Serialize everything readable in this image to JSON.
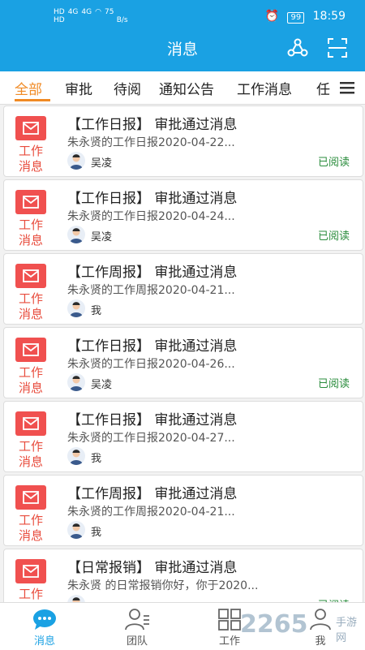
{
  "status_bar": {
    "left_top": "HD",
    "left_bottom": "HD",
    "net1": "4G",
    "net2": "4G",
    "speed_value": "75",
    "speed_unit": "B/s",
    "battery": "99",
    "time": "18:59"
  },
  "header": {
    "title": "消息",
    "left_icon": "share-icon",
    "right_icon": "scan-icon"
  },
  "tabs": [
    "全部",
    "审批",
    "待阅",
    "通知公告",
    "工作消息",
    "任"
  ],
  "messages": [
    {
      "category": "工作消息",
      "title": "【工作日报】 审批通过消息",
      "preview": "朱永贤的工作日报2020-04-22...",
      "author": "吴凌",
      "read": "已阅读"
    },
    {
      "category": "工作消息",
      "title": "【工作日报】 审批通过消息",
      "preview": "朱永贤的工作日报2020-04-24...",
      "author": "吴凌",
      "read": "已阅读"
    },
    {
      "category": "工作消息",
      "title": "【工作周报】 审批通过消息",
      "preview": "朱永贤的工作周报2020-04-21...",
      "author": "我",
      "read": ""
    },
    {
      "category": "工作消息",
      "title": "【工作日报】 审批通过消息",
      "preview": "朱永贤的工作日报2020-04-26...",
      "author": "吴凌",
      "read": "已阅读"
    },
    {
      "category": "工作消息",
      "title": "【工作日报】 审批通过消息",
      "preview": "朱永贤的工作日报2020-04-27...",
      "author": "我",
      "read": ""
    },
    {
      "category": "工作消息",
      "title": "【工作周报】 审批通过消息",
      "preview": "朱永贤的工作周报2020-04-21...",
      "author": "我",
      "read": ""
    },
    {
      "category": "工作消息",
      "title": "【日常报销】 审批通过消息",
      "preview": "朱永贤 的日常报销你好，你于2020...",
      "author": "",
      "read": "已阅读"
    }
  ],
  "bottom_nav": [
    {
      "label": "消息",
      "icon": "chat-bubble-icon"
    },
    {
      "label": "团队",
      "icon": "team-icon"
    },
    {
      "label": "工作",
      "icon": "grid-icon"
    },
    {
      "label": "我",
      "icon": "profile-icon"
    }
  ],
  "watermark": {
    "text": "2265",
    "suffix": "手游网"
  },
  "colors": {
    "primary": "#1aa1e3",
    "accent": "#f08a24",
    "badge": "#f0504f",
    "read": "#2a8c3c"
  }
}
